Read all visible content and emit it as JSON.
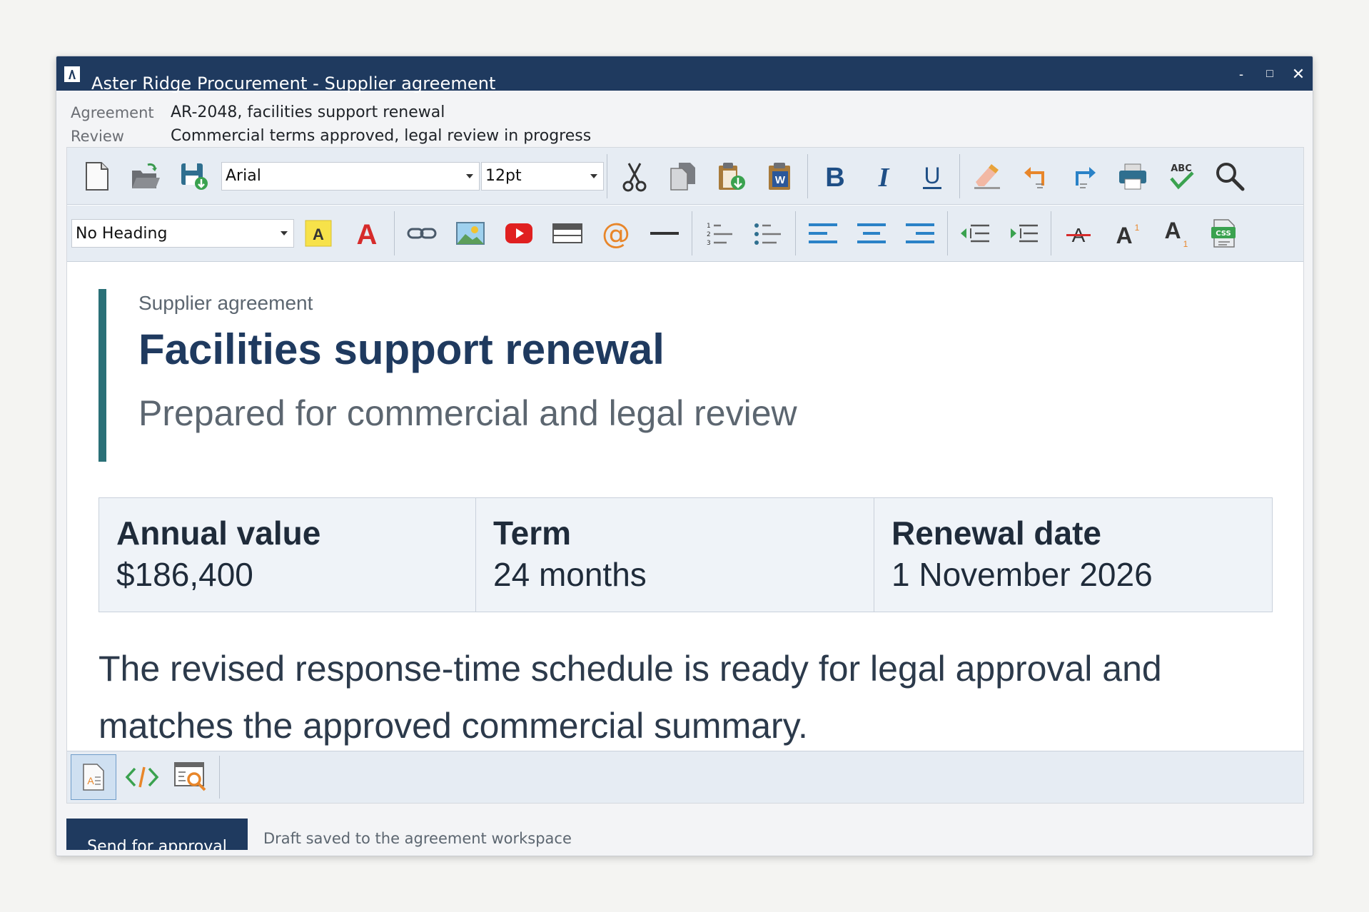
{
  "window": {
    "title": "Aster Ridge Procurement - Supplier agreement",
    "controls": {
      "minimize": "-",
      "maximize": "□",
      "close": "✕"
    }
  },
  "meta": {
    "agreement_label": "Agreement",
    "agreement_value": "AR-2048, facilities support renewal",
    "review_label": "Review",
    "review_value": "Commercial terms approved, legal review in progress"
  },
  "toolbar": {
    "font_family": "Arial",
    "font_size": "12pt",
    "heading_style": "No Heading",
    "highlight_letter": "A",
    "font_color_letter": "A",
    "spellcheck_label": "ABC",
    "css_label": "CSS"
  },
  "document": {
    "eyebrow": "Supplier agreement",
    "title": "Facilities support renewal",
    "subtitle": "Prepared for commercial and legal review",
    "facts": [
      {
        "label": "Annual value",
        "value": "$186,400"
      },
      {
        "label": "Term",
        "value": "24 months"
      },
      {
        "label": "Renewal date",
        "value": "1 November 2026"
      }
    ],
    "paragraph": "The revised response-time schedule is ready for legal approval and matches the approved commercial summary."
  },
  "status": {
    "primary_button": "Send for approval",
    "message": "Draft saved to the agreement workspace"
  },
  "colors": {
    "titlebar": "#1f3a5f",
    "accent_bar": "#2a7077",
    "heading": "#1f3a5f"
  }
}
